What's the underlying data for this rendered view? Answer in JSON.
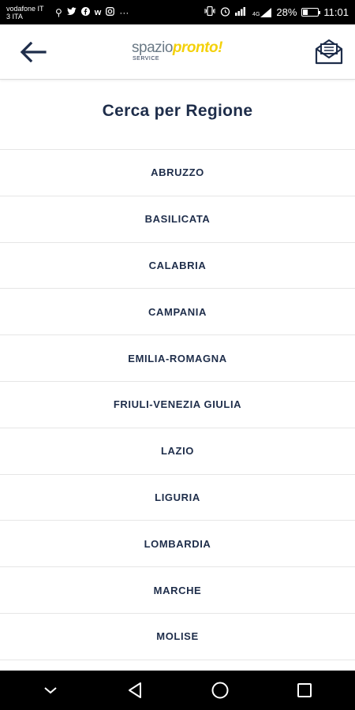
{
  "status_bar": {
    "carrier_line1": "vodafone IT",
    "carrier_line2": "3 ITA",
    "battery": "28%",
    "time": "11:01",
    "left_icons": [
      "usb-icon",
      "twitter-icon",
      "facebook-icon",
      "app-icon",
      "instagram-icon",
      "more-icon"
    ],
    "right_icons": [
      "vibrate-icon",
      "alarm-icon",
      "wifi-icon",
      "signal-icon",
      "battery-icon"
    ],
    "signal_label": "4G"
  },
  "header": {
    "logo_part1": "spazio",
    "logo_part2": "pronto!",
    "logo_sub": "SERVICE",
    "colors": {
      "brand_yellow": "#f4d10a",
      "brand_navy": "#1e2d4a"
    }
  },
  "page": {
    "title": "Cerca per Regione"
  },
  "regions": [
    "ABRUZZO",
    "BASILICATA",
    "CALABRIA",
    "CAMPANIA",
    "EMILIA-ROMAGNA",
    "FRIULI-VENEZIA GIULIA",
    "LAZIO",
    "LIGURIA",
    "LOMBARDIA",
    "MARCHE",
    "MOLISE"
  ]
}
